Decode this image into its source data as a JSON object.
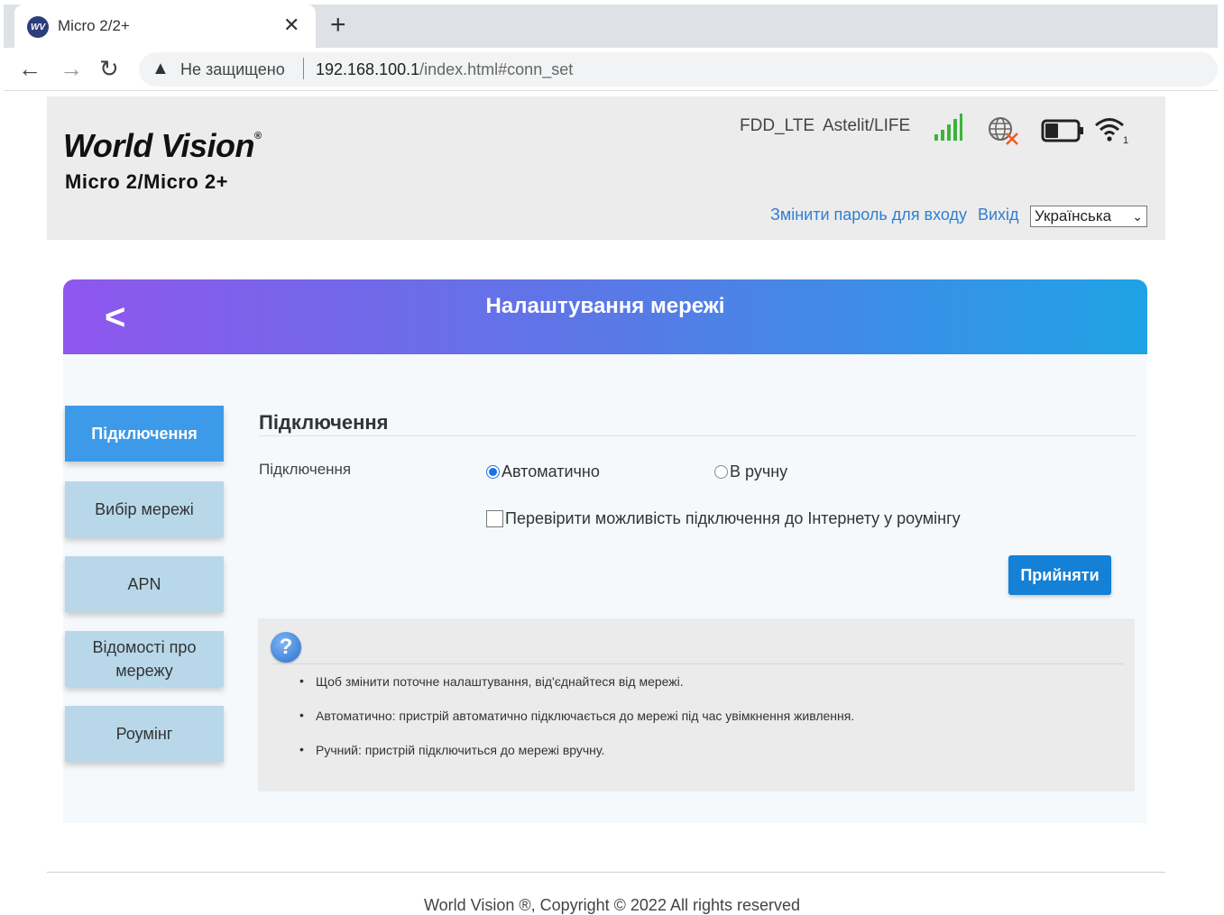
{
  "browser": {
    "tab_title": "Micro 2/2+",
    "favicon_text": "WV",
    "close_icon": "close-icon",
    "new_tab_icon": "plus-icon",
    "security_label": "Не защищено",
    "url_host": "192.168.100.1",
    "url_path": "/index.html#conn_set"
  },
  "header": {
    "brand": "World Vision",
    "brand_mark": "®",
    "model": "Micro 2/Micro 2+",
    "network_type": "FDD_LTE",
    "operator": "Astelit/LIFE",
    "wifi_clients": "1",
    "change_password": "Змінити пароль для входу",
    "logout": "Вихід",
    "language": "Українська"
  },
  "page": {
    "title": "Налаштування мережі",
    "menu": [
      {
        "label": "Підключення",
        "active": true
      },
      {
        "label": "Вибір мережі",
        "active": false
      },
      {
        "label": "APN",
        "active": false
      },
      {
        "label": "Відомості про мережу",
        "active": false
      },
      {
        "label": "Роумінг",
        "active": false
      }
    ],
    "section_title": "Підключення",
    "connection_label": "Підключення",
    "mode_auto": "Автоматично",
    "mode_manual": "В ручну",
    "selected_mode": "auto",
    "roaming_check": "Перевірити можливість підключення до Інтернету у роумінгу",
    "roaming_checked": false,
    "apply": "Прийняти",
    "help": [
      "Щоб змінити поточне налаштування, від'єднайтеся від мережі.",
      "Автоматично: пристрій автоматично підключається до мережі під час увімкнення живлення.",
      "Ручний: пристрій підключиться до мережі вручну."
    ]
  },
  "footer": "World Vision ®, Copyright © 2022 All rights reserved",
  "colors": {
    "accent": "#1480d6",
    "menu_active": "#3d9ae8",
    "menu_inactive": "#b8d8ea",
    "banner_start": "#8f56ee",
    "banner_end": "#1fa3e6",
    "link": "#2f7fd1",
    "signal": "#3cb43c",
    "no_internet": "#f05a28"
  }
}
